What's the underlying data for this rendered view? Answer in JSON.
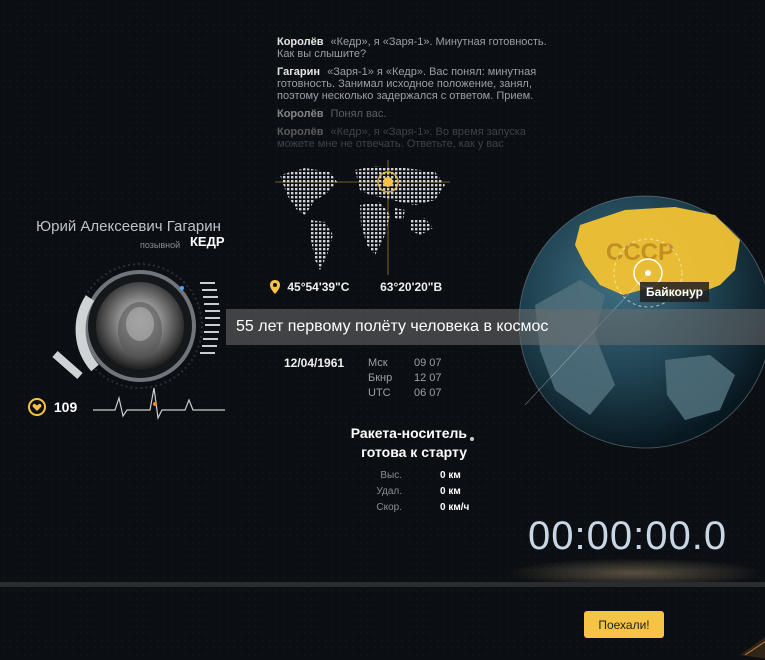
{
  "chat": [
    {
      "who": "Королёв",
      "text": "«Кедр», я «Заря-1». Минутная готовность. Как вы слышите?"
    },
    {
      "who": "Гагарин",
      "text": "«Заря-1» я «Кедр». Вас понял: минутная готовность. Занимал исходное положение, занял, поэтому несколько задержался с ответом. Прием."
    },
    {
      "who": "Королёв",
      "text": "Понял вас."
    },
    {
      "who": "Королёв",
      "text": "«Кедр», я «Заря-1». Во время запуска можете мне не отвечать. Ответьте, как у вас"
    }
  ],
  "coords": {
    "lat": "45°54'39\"С",
    "lon": "63°20'20\"В"
  },
  "pilot": {
    "name": "Юрий Алексеевич Гагарин",
    "callsign_label": "позывной",
    "callsign": "КЕДР",
    "heart_rate": "109"
  },
  "headline": "55 лет первому полёту человека в космос",
  "date": "12/04/1961",
  "times": [
    {
      "tz": "Мск",
      "time": "09 07"
    },
    {
      "tz": "Бкнр",
      "time": "12 07"
    },
    {
      "tz": "UTC",
      "time": "06 07"
    }
  ],
  "status": {
    "line1": "Ракета-носитель",
    "line2": "готова к старту"
  },
  "telemetry": [
    {
      "label": "Выс.",
      "value": "0 км"
    },
    {
      "label": "Удал.",
      "value": "0 км"
    },
    {
      "label": "Скор.",
      "value": "0 км/ч"
    }
  ],
  "globe": {
    "label": "Байконур",
    "region_text": "СССР"
  },
  "timer": "00:00:00.0",
  "go_button": "Поехали!",
  "colors": {
    "accent": "#f6c344",
    "background": "#0b0e12"
  }
}
